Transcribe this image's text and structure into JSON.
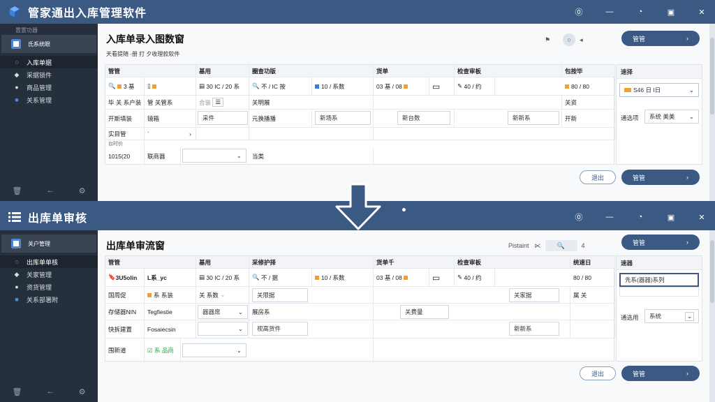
{
  "window1": {
    "app_title": "管家通出入库管理软件",
    "sidebar": {
      "top_label": "置置功器",
      "user_label": "氏系统眼",
      "items": [
        {
          "label": "入库单据",
          "icon": "circle-icon",
          "active": true
        },
        {
          "label": "采据锁件",
          "icon": "layers-icon",
          "active": false
        },
        {
          "label": "商品管理",
          "icon": "disc-icon",
          "active": false
        },
        {
          "label": "关系管理",
          "icon": "square-icon",
          "active": false
        }
      ]
    },
    "page_title": "入库单录入图数窗",
    "subline": "天看提随 -册 打 夕收理款软件",
    "tools": {
      "flag": "⚑",
      "more": "◂"
    },
    "top_button": "管管",
    "headers": [
      "管管",
      "基用",
      "圈查功版",
      "货单",
      "检查审板",
      "包按毕"
    ],
    "row1": [
      "3 基",
      "30 IC / 20 系",
      "不 / IC 按",
      "10 / 系数",
      "03 基 / 08",
      "40 / 约",
      "80 / 80"
    ],
    "row2": [
      "毕 关 系户装",
      "管 关管系",
      "",
      "关明展",
      "",
      "",
      "",
      "关资"
    ],
    "row3": [
      "开斯填装",
      "镜箱",
      "采件",
      "元换播播",
      "新场系",
      "新台数",
      "新新系",
      "开新"
    ],
    "row4": [
      "实目管"
    ],
    "row5": [
      "台时价",
      ""
    ],
    "row6": [
      "1015(20",
      "联商器",
      "",
      "当类"
    ],
    "right_panel": {
      "header": "速择",
      "select_value": "S46 日 I日",
      "label2": "通选项",
      "select2": "系统 美美"
    },
    "cancel_button": "退出",
    "confirm_button": "管管"
  },
  "window2": {
    "app_title": "出库单审核",
    "sidebar": {
      "top_label": "",
      "user_label": "关户管理",
      "items": [
        {
          "label": "出库单单核",
          "icon": "circle-icon",
          "active": true
        },
        {
          "label": "关家管理",
          "icon": "layers-icon",
          "active": false
        },
        {
          "label": "资货管理",
          "icon": "disc-icon",
          "active": false
        },
        {
          "label": "关系部署附",
          "icon": "square-icon",
          "active": false
        }
      ]
    },
    "page_title": "出库单审流窗",
    "tools": {
      "label": "Pistaint",
      "prev": "⋉",
      "more": "4"
    },
    "top_button": "管管",
    "headers": [
      "管管",
      "基用",
      "采修护择",
      "货单千",
      "检查审板",
      "统速日"
    ],
    "row1": [
      "3U5olin",
      "L系_yc",
      "30 IC / 20 系",
      "不 / 据",
      "10 / 系数",
      "03 基 / 08",
      "40 / 约",
      "80 / 80"
    ],
    "row2": [
      "国周促",
      "系 系装",
      "关 系数",
      "关限据",
      "关家据",
      "属 关"
    ],
    "row3": [
      "存储器NIN",
      "Tegfiestie",
      "器器席",
      "展房系",
      "关费量"
    ],
    "row4": [
      "快拆建置",
      "Fosaiecsin",
      "视高货件",
      "新新系"
    ],
    "row5": [
      "围新道",
      "系 品商"
    ],
    "right_panel": {
      "header": "速器",
      "input_value": "先系(器器)系列",
      "label2": "通选用",
      "select2": "系统"
    },
    "cancel_button": "退出",
    "confirm_button": "管管"
  },
  "colors": {
    "brand": "#3a5a84",
    "sidebar": "#26303d",
    "accent_orange": "#f0a030",
    "accent_blue": "#3a7ad8",
    "accent_red": "#e04c3c",
    "accent_green": "#38a048"
  }
}
